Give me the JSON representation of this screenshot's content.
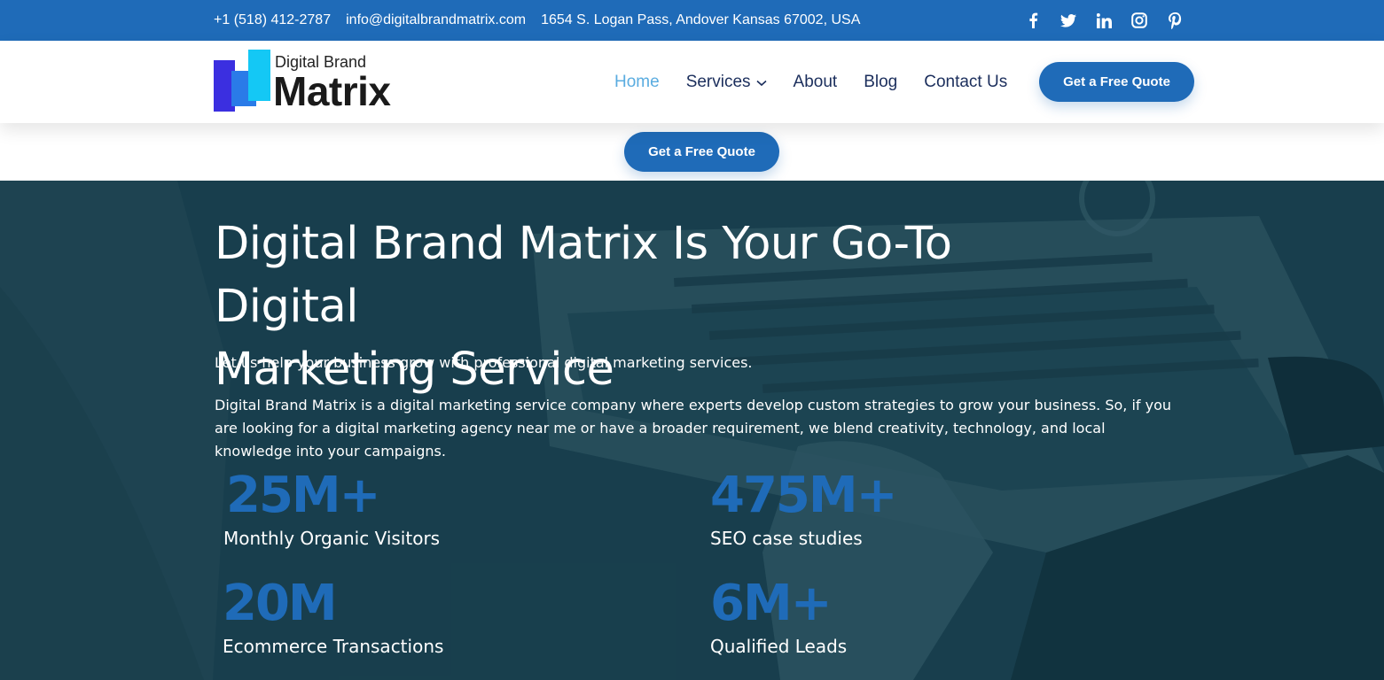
{
  "topbar": {
    "phone": "+1 (518) 412-2787",
    "email": "info@digitalbrandmatrix.com",
    "address": "1654 S. Logan Pass, Andover Kansas 67002, USA",
    "social": [
      "facebook-icon",
      "twitter-icon",
      "linkedin-icon",
      "instagram-icon",
      "pinterest-icon"
    ]
  },
  "logo": {
    "small": "Digital Brand",
    "big": "Matrix"
  },
  "nav": {
    "items": [
      {
        "label": "Home",
        "active": true
      },
      {
        "label": "Services",
        "has_dropdown": true
      },
      {
        "label": "About"
      },
      {
        "label": "Blog"
      },
      {
        "label": "Contact Us"
      }
    ],
    "cta": "Get a Free Quote"
  },
  "cta_strip": {
    "button": "Get a Free Quote"
  },
  "hero": {
    "title_line1": "Digital Brand Matrix Is Your Go-To Digital",
    "title_line2": "Marketing Service",
    "lead": "Let us help your business grow with professional digital marketing services.",
    "description": "Digital Brand Matrix is a digital marketing service company  where experts develop custom strategies to grow your business. So, if you are looking for a digital marketing agency near me or have a broader requirement, we blend creativity, technology, and local knowledge into your campaigns."
  },
  "stats": [
    {
      "value": "25M+",
      "label": "Monthly Organic Visitors"
    },
    {
      "value": "475M+",
      "label": "SEO case studies"
    },
    {
      "value": "20M",
      "label": "Ecommerce Transactions"
    },
    {
      "value": "6M+",
      "label": "Qualified Leads"
    }
  ],
  "colors": {
    "brand_blue": "#1f6bb8",
    "nav_text": "#1b2e5c",
    "nav_active": "#5aace0",
    "hero_bg": "#1b3e4c"
  }
}
